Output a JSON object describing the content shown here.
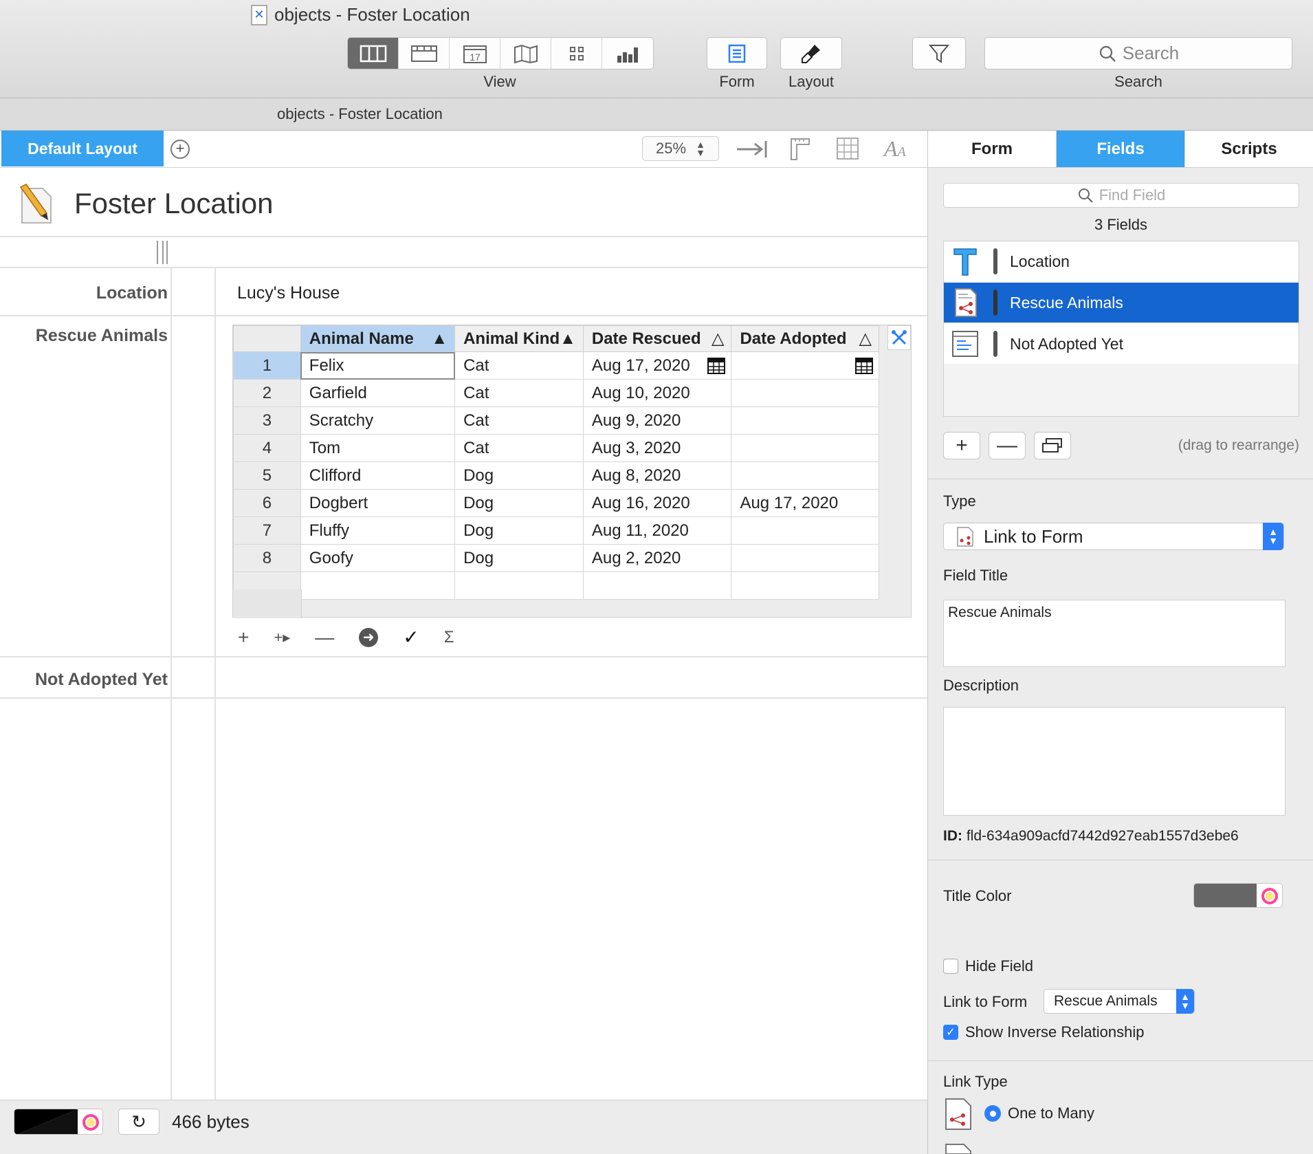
{
  "window": {
    "title": "objects - Foster Location",
    "subtitle": "objects - Foster Location"
  },
  "toolbar": {
    "view_label": "View",
    "form_label": "Form",
    "layout_label": "Layout",
    "search_label": "Search",
    "search_placeholder": "Search",
    "calendar_day": "17"
  },
  "layout_tabs": {
    "default": "Default Layout",
    "zoom": "25%"
  },
  "form": {
    "title": "Foster Location",
    "fields": {
      "location_label": "Location",
      "location_value": "Lucy's House",
      "rescue_label": "Rescue Animals",
      "not_adopted_label": "Not Adopted Yet"
    }
  },
  "table": {
    "columns": [
      "Animal Name",
      "Animal Kind",
      "Date Rescued",
      "Date Adopted"
    ],
    "rows": [
      {
        "n": "1",
        "name": "Felix",
        "kind": "Cat",
        "rescued": "Aug 17, 2020",
        "adopted": ""
      },
      {
        "n": "2",
        "name": "Garfield",
        "kind": "Cat",
        "rescued": "Aug 10, 2020",
        "adopted": ""
      },
      {
        "n": "3",
        "name": "Scratchy",
        "kind": "Cat",
        "rescued": "Aug 9, 2020",
        "adopted": ""
      },
      {
        "n": "4",
        "name": "Tom",
        "kind": "Cat",
        "rescued": "Aug 3, 2020",
        "adopted": ""
      },
      {
        "n": "5",
        "name": "Clifford",
        "kind": "Dog",
        "rescued": "Aug 8, 2020",
        "adopted": ""
      },
      {
        "n": "6",
        "name": "Dogbert",
        "kind": "Dog",
        "rescued": "Aug 16, 2020",
        "adopted": "Aug 17, 2020"
      },
      {
        "n": "7",
        "name": "Fluffy",
        "kind": "Dog",
        "rescued": "Aug 11, 2020",
        "adopted": ""
      },
      {
        "n": "8",
        "name": "Goofy",
        "kind": "Dog",
        "rescued": "Aug 2, 2020",
        "adopted": ""
      }
    ]
  },
  "status": {
    "size": "466 bytes"
  },
  "sidebar": {
    "tabs": [
      "Form",
      "Fields",
      "Scripts"
    ],
    "find_placeholder": "Find Field",
    "count": "3 Fields",
    "fields": [
      "Location",
      "Rescue Animals",
      "Not Adopted Yet"
    ],
    "drag_hint": "(drag to rearrange)",
    "type_label": "Type",
    "type_value": "Link to Form",
    "field_title_label": "Field Title",
    "field_title_value": "Rescue Animals",
    "description_label": "Description",
    "id_label": "ID:",
    "id_value": "fld-634a909acfd7442d927eab1557d3ebe6",
    "title_color_label": "Title Color",
    "hide_field_label": "Hide Field",
    "link_to_form_label": "Link to Form",
    "link_to_form_value": "Rescue Animals",
    "show_inverse_label": "Show Inverse Relationship",
    "link_type_label": "Link Type",
    "link_type_value": "One to Many"
  },
  "colors": {
    "accent": "#36a2f0",
    "selection": "#1565d0",
    "title_color": "#666666"
  }
}
